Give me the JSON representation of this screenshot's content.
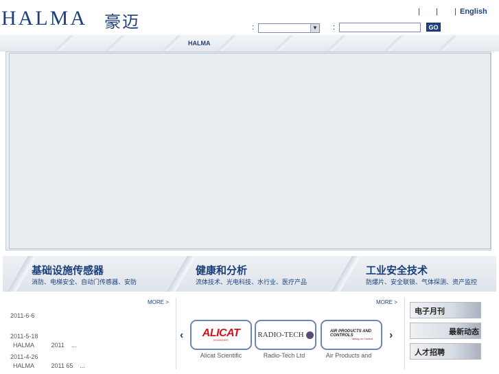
{
  "header": {
    "logo_text": "HALMA",
    "logo_cn": "豪迈",
    "links": [
      "|",
      "|",
      "|"
    ],
    "english": "English",
    "colon1": ":",
    "colon2": ":",
    "select_value": "",
    "search_value": "",
    "go_label": "GO"
  },
  "nav": {
    "center_label": "HALMA"
  },
  "categories": [
    {
      "title": "基础设施传感器",
      "subtitle": "消防、电梯安全、自动门传感器、安防"
    },
    {
      "title": "健康和分析",
      "subtitle": "流体技术、光电科技、水行业、医疗产品"
    },
    {
      "title": "工业安全技术",
      "subtitle": "防爆片、安全联锁、气体探测、资产监控"
    }
  ],
  "news": {
    "more": "MORE >",
    "items": [
      {
        "date": "2011-6-6",
        "text": ""
      },
      {
        "date": "2011-5-18",
        "text": "HALMA          2011    ..."
      },
      {
        "date": "2011-4-26",
        "text": "HALMA          2011 65    ..."
      }
    ]
  },
  "brands": {
    "more": "MORE >",
    "items": [
      {
        "logo": "ALICAT",
        "logo_sub": "SCIENTIFIC",
        "caption": "Alicat Scientific"
      },
      {
        "logo": "RADIO-TECH",
        "logo_sub": "",
        "caption": "Radio-Tech Ltd"
      },
      {
        "logo": "AIR PRODUCTS AND CONTROLS",
        "logo_sub": "Taking on Control",
        "caption": "Air Products and"
      }
    ],
    "prev": "‹",
    "next": "›"
  },
  "sidebar": {
    "items": [
      "电子月刊",
      "最新动态",
      "人才招聘"
    ]
  },
  "colors": {
    "brand_blue": "#1f3f7a",
    "go_bg": "#24437e",
    "alicat_red": "#d0121b"
  }
}
